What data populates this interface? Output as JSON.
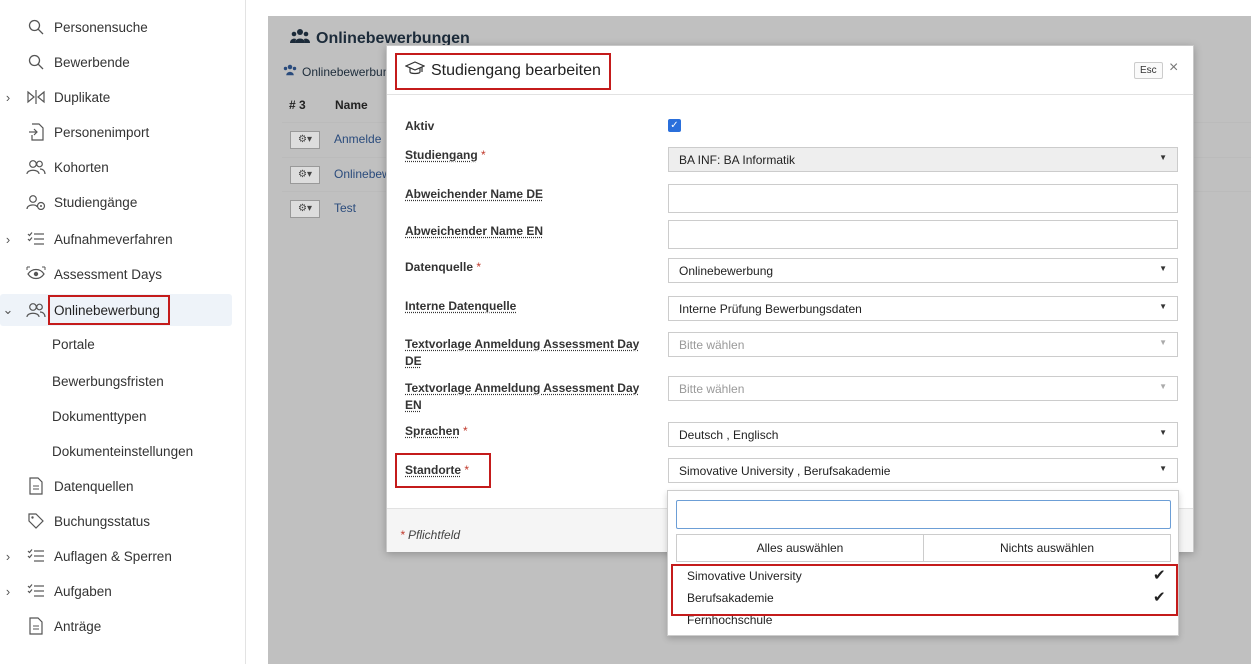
{
  "sidebar": {
    "items": [
      {
        "label": "Personensuche",
        "icon": "search-icon"
      },
      {
        "label": "Bewerbende",
        "icon": "search-icon"
      },
      {
        "label": "Duplikate",
        "icon": "compare-icon"
      },
      {
        "label": "Personenimport",
        "icon": "import-icon"
      },
      {
        "label": "Kohorten",
        "icon": "users-icon"
      },
      {
        "label": "Studiengänge",
        "icon": "user-course-icon"
      },
      {
        "label": "Aufnahmeverfahren",
        "icon": "checklist-icon"
      },
      {
        "label": "Assessment Days",
        "icon": "eye-target-icon"
      },
      {
        "label": "Onlinebewerbung",
        "icon": "users-icon"
      },
      {
        "label": "Portale"
      },
      {
        "label": "Bewerbungsfristen"
      },
      {
        "label": "Dokumenttypen"
      },
      {
        "label": "Dokumenteinstellungen"
      },
      {
        "label": "Datenquellen",
        "icon": "document-icon"
      },
      {
        "label": "Buchungsstatus",
        "icon": "tag-icon"
      },
      {
        "label": "Auflagen & Sperren",
        "icon": "checklist-icon"
      },
      {
        "label": "Aufgaben",
        "icon": "checklist-icon"
      },
      {
        "label": "Anträge",
        "icon": "document-icon"
      }
    ]
  },
  "page": {
    "title": "Onlinebewerbungen",
    "breadcrumb": "Onlinebewerbun",
    "table": {
      "count_header": "# 3",
      "name_header": "Name",
      "rows": [
        "Anmelde",
        "Onlinebew",
        "Test"
      ]
    }
  },
  "modal": {
    "title": "Studiengang bearbeiten",
    "esc_label": "Esc",
    "close_label": "×",
    "fields": {
      "aktiv": {
        "label": "Aktiv",
        "checked": true
      },
      "studiengang": {
        "label": "Studiengang",
        "required": "*",
        "value": "BA INF: BA Informatik"
      },
      "name_de": {
        "label": "Abweichender Name DE",
        "value": ""
      },
      "name_en": {
        "label": "Abweichender Name EN",
        "value": ""
      },
      "datenquelle": {
        "label": "Datenquelle",
        "required": "*",
        "value": "Onlinebewerbung"
      },
      "interne_datenquelle": {
        "label": "Interne Datenquelle",
        "value": "Interne Prüfung Bewerbungsdaten"
      },
      "textvorlage_de": {
        "label_line1": "Textvorlage Anmeldung Assessment Day",
        "label_line2": "DE",
        "placeholder": "Bitte wählen"
      },
      "textvorlage_en": {
        "label_line1": "Textvorlage Anmeldung Assessment Day",
        "label_line2": "EN",
        "placeholder": "Bitte wählen"
      },
      "sprachen": {
        "label": "Sprachen",
        "required": "*",
        "value": "Deutsch , Englisch"
      },
      "standorte": {
        "label": "Standorte",
        "required": "*",
        "value": "Simovative University , Berufsakademie"
      }
    },
    "footer_note": "Pflichtfeld",
    "footer_star": "*"
  },
  "dropdown": {
    "search_value": "",
    "select_all": "Alles auswählen",
    "select_none": "Nichts auswählen",
    "options": [
      {
        "label": "Simovative University",
        "selected": true
      },
      {
        "label": "Berufsakademie",
        "selected": true
      },
      {
        "label": "Fernhochschule",
        "selected": false
      }
    ],
    "check_glyph": "✔"
  },
  "colors": {
    "accent": "#2a6fdb",
    "highlight_box": "#c41b1b",
    "required": "#c0392b"
  }
}
